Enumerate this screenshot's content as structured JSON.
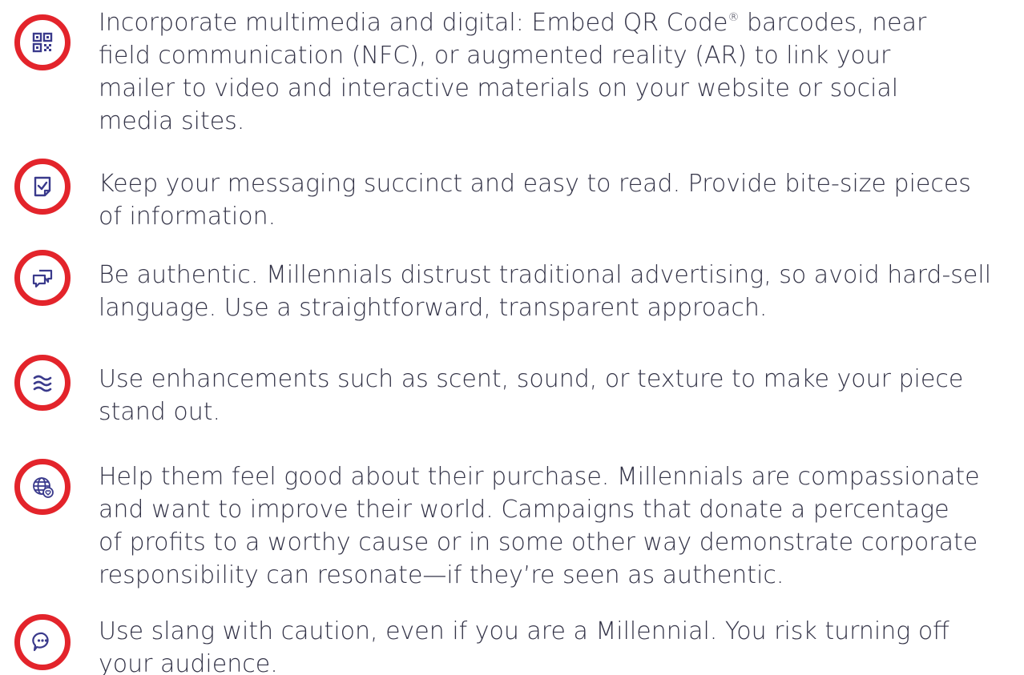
{
  "colors": {
    "badge_ring": "#e3242b",
    "icon": "#3a3a8c",
    "text": "#333347"
  },
  "tips": [
    {
      "icon": "qr-code-icon",
      "lines": [
        "Incorporate multimedia and digital: Embed QR Code",
        " barcodes, near",
        "field communication (NFC), or augmented reality (AR) to link your",
        "mailer to video and interactive materials on your website or social",
        "media sites."
      ],
      "trademark": "®"
    },
    {
      "icon": "checklist-document-icon",
      "lines": [
        "Keep your messaging succinct and easy to read. Provide bite-size pieces",
        "of information."
      ]
    },
    {
      "icon": "chat-bubbles-icon",
      "lines": [
        "Be authentic. Millennials distrust traditional advertising, so avoid hard-sell",
        "language. Use a straightforward, transparent approach."
      ]
    },
    {
      "icon": "scent-waves-icon",
      "lines": [
        "Use enhancements such as scent, sound, or texture to make your piece",
        "stand out."
      ]
    },
    {
      "icon": "globe-heart-icon",
      "lines": [
        "Help them feel good about their purchase. Millennials are compassionate",
        "and want to improve their world. Campaigns that donate a percentage",
        "of profits to a worthy cause or in some other way demonstrate corporate",
        "responsibility can resonate—if they’re seen as authentic."
      ]
    },
    {
      "icon": "speech-bubble-icon",
      "lines": [
        "Use slang with caution, even if you are a Millennial. You risk turning off",
        "your audience."
      ]
    }
  ]
}
